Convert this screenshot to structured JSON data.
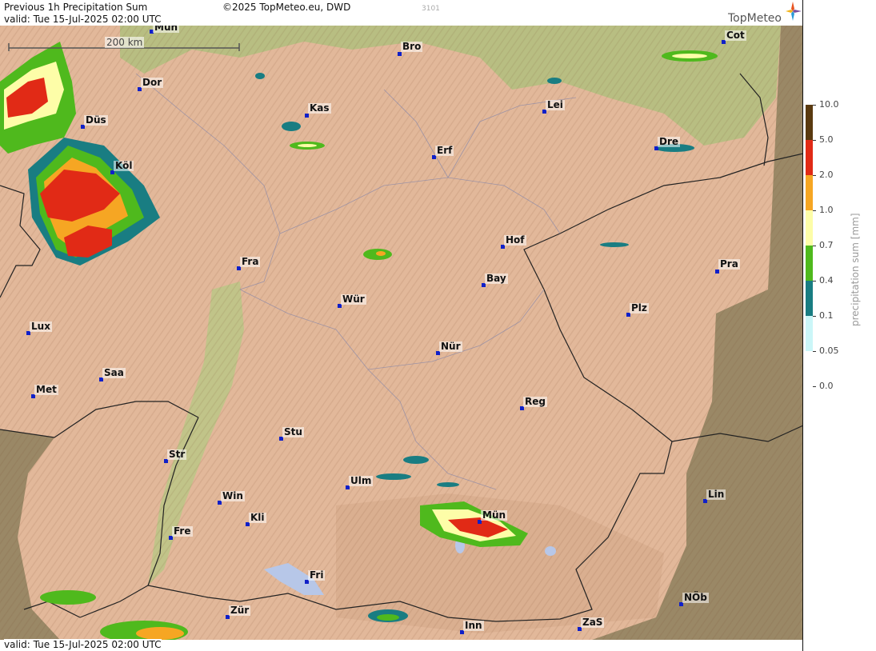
{
  "header": {
    "product": "Previous 1h Precipitation Sum",
    "valid_top": "valid:  Tue  15-Jul-2025 02:00 UTC",
    "copyright": "©2025 TopMeteo.eu, DWD",
    "code": "3101",
    "valid_bottom": "valid:  Tue  15-Jul-2025 02:00 UTC"
  },
  "brand": {
    "name": "TopMeteo"
  },
  "scale_bar": {
    "label": "200 km"
  },
  "legend": {
    "title": "precipitation sum [mm]",
    "levels": [
      {
        "label": "10.0",
        "color": "#5a3a10"
      },
      {
        "label": "5.0",
        "color": "#e12a16"
      },
      {
        "label": "2.0",
        "color": "#f6a623"
      },
      {
        "label": "1.0",
        "color": "#fdfda8"
      },
      {
        "label": "0.7",
        "color": "#4fb91d"
      },
      {
        "label": "0.4",
        "color": "#197d82"
      },
      {
        "label": "0.1",
        "color": "#cbf6f8"
      },
      {
        "label": "0.05",
        "color": ""
      },
      {
        "label": "0.0",
        "color": ""
      }
    ]
  },
  "cities": [
    {
      "label": "Mün",
      "id": "city-munchen-top"
    },
    {
      "label": "Bro",
      "id": "city-bro"
    },
    {
      "label": "Cot",
      "id": "city-cot"
    },
    {
      "label": "Dor",
      "id": "city-dor"
    },
    {
      "label": "Kas",
      "id": "city-kas"
    },
    {
      "label": "Lei",
      "id": "city-lei"
    },
    {
      "label": "Düs",
      "id": "city-dus"
    },
    {
      "label": "Erf",
      "id": "city-erf"
    },
    {
      "label": "Dre",
      "id": "city-dre"
    },
    {
      "label": "Köl",
      "id": "city-kol"
    },
    {
      "label": "Hof",
      "id": "city-hof"
    },
    {
      "label": "Fra",
      "id": "city-fra"
    },
    {
      "label": "Pra",
      "id": "city-pra"
    },
    {
      "label": "Bay",
      "id": "city-bay"
    },
    {
      "label": "Wür",
      "id": "city-wur"
    },
    {
      "label": "Plz",
      "id": "city-plz"
    },
    {
      "label": "Lux",
      "id": "city-lux"
    },
    {
      "label": "Nür",
      "id": "city-nur"
    },
    {
      "label": "Saa",
      "id": "city-saa"
    },
    {
      "label": "Met",
      "id": "city-met"
    },
    {
      "label": "Reg",
      "id": "city-reg"
    },
    {
      "label": "Stu",
      "id": "city-stu"
    },
    {
      "label": "Str",
      "id": "city-str"
    },
    {
      "label": "Ulm",
      "id": "city-ulm"
    },
    {
      "label": "Win",
      "id": "city-win"
    },
    {
      "label": "Lin",
      "id": "city-lin"
    },
    {
      "label": "Kli",
      "id": "city-kli"
    },
    {
      "label": "Mün",
      "id": "city-munchen"
    },
    {
      "label": "Fre",
      "id": "city-fre"
    },
    {
      "label": "Fri",
      "id": "city-fri"
    },
    {
      "label": "NÖb",
      "id": "city-nob"
    },
    {
      "label": "Zür",
      "id": "city-zur"
    },
    {
      "label": "Inn",
      "id": "city-inn"
    },
    {
      "label": "ZaS",
      "id": "city-zas"
    }
  ]
}
